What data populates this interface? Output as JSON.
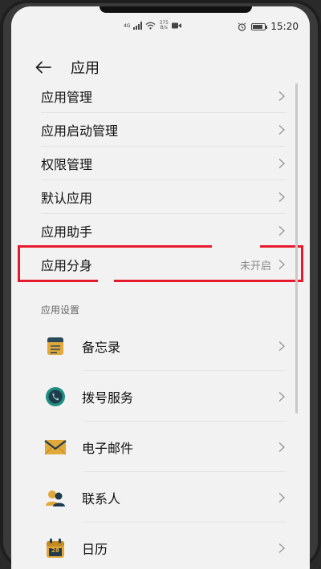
{
  "status_bar": {
    "network_type": "4G",
    "net_speed_value": "375",
    "net_speed_unit": "B/s",
    "time": "15:20",
    "battery_level": 0.75
  },
  "header": {
    "back_icon": "arrow-left-icon",
    "title": "应用"
  },
  "menu": {
    "items": [
      {
        "label": "应用管理"
      },
      {
        "label": "应用启动管理"
      },
      {
        "label": "权限管理"
      },
      {
        "label": "默认应用"
      },
      {
        "label": "应用助手"
      },
      {
        "label": "应用分身",
        "value": "未开启"
      }
    ]
  },
  "app_settings": {
    "section_title": "应用设置",
    "items": [
      {
        "label": "备忘录",
        "icon": "notepad-icon"
      },
      {
        "label": "拨号服务",
        "icon": "phone-icon"
      },
      {
        "label": "电子邮件",
        "icon": "mail-icon"
      },
      {
        "label": "联系人",
        "icon": "contacts-icon"
      },
      {
        "label": "日历",
        "icon": "calendar-icon",
        "icon_text": "28"
      }
    ]
  },
  "colors": {
    "highlight": "#e8192c",
    "icon_gold": "#e2a93a",
    "icon_teal": "#1f8f82",
    "icon_dark": "#1f3b4d"
  }
}
